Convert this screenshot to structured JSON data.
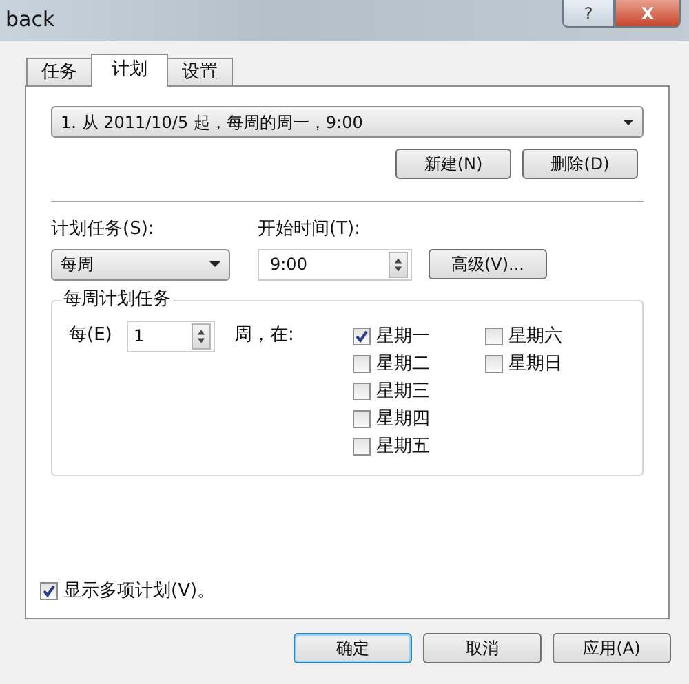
{
  "window": {
    "title": "back",
    "help": "?",
    "close": "X"
  },
  "tabs": [
    {
      "label": "任务",
      "selected": false
    },
    {
      "label": "计划",
      "selected": true
    },
    {
      "label": "设置",
      "selected": false
    }
  ],
  "schedule_list": {
    "value": "1. 从 2011/10/5 起，每周的周一，9:00"
  },
  "list_buttons": [
    "新建(N)",
    "删除(D)"
  ],
  "schedule_task": {
    "label": "计划任务(S):",
    "value": "每周"
  },
  "start_time": {
    "label": "开始时间(T):",
    "value": "9:00"
  },
  "advanced_button": "高级(V)...",
  "weekly_group": {
    "title": "每周计划任务",
    "every_label": "每(E)",
    "every_value": "1",
    "unit_label": "周，在:",
    "days": [
      {
        "label": "星期一",
        "checked": true
      },
      {
        "label": "星期二",
        "checked": false
      },
      {
        "label": "星期三",
        "checked": false
      },
      {
        "label": "星期四",
        "checked": false
      },
      {
        "label": "星期五",
        "checked": false
      },
      {
        "label": "星期六",
        "checked": false
      },
      {
        "label": "星期日",
        "checked": false
      }
    ]
  },
  "show_multiple": {
    "label": "显示多项计划(V)。",
    "checked": true
  },
  "footer_buttons": [
    {
      "label": "确定",
      "default": true
    },
    {
      "label": "取消",
      "default": false
    },
    {
      "label": "应用(A)",
      "default": false
    }
  ]
}
